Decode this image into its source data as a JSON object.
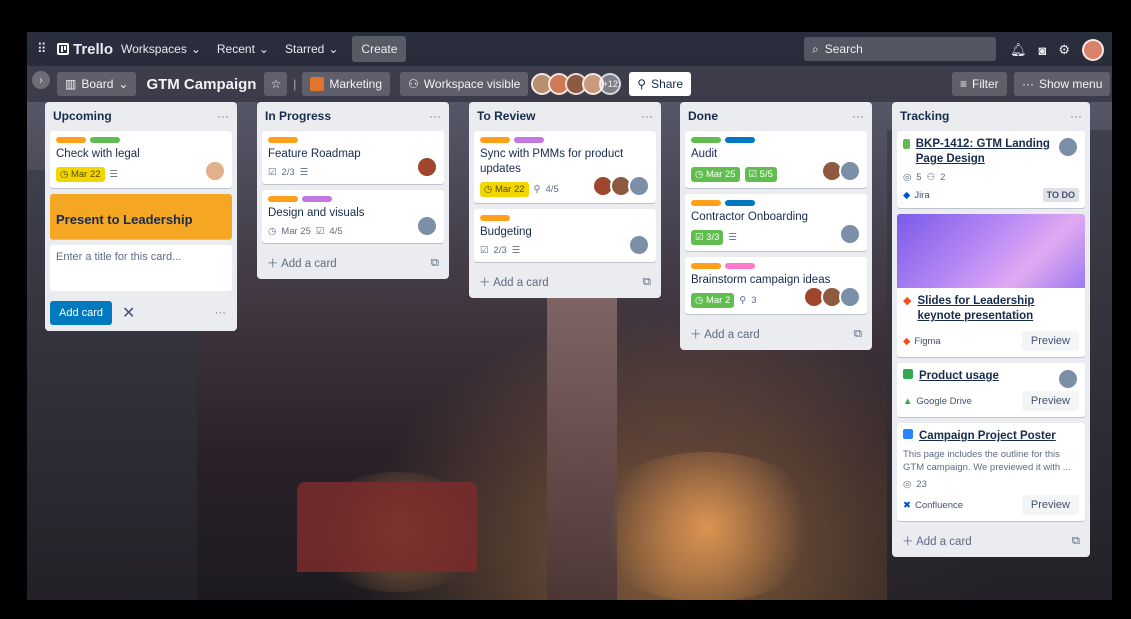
{
  "topbar": {
    "workspaces": "Workspaces",
    "recent": "Recent",
    "starred": "Starred",
    "create": "Create",
    "search_placeholder": "Search",
    "logo": "Trello"
  },
  "board": {
    "view": "Board",
    "title": "GTM Campaign",
    "team": "Marketing",
    "visibility": "Workspace visible",
    "members_more": "+12",
    "share": "Share",
    "filter": "Filter",
    "show_menu": "Show menu"
  },
  "lists": [
    {
      "title": "Upcoming",
      "cards": [
        {
          "title": "Check with legal",
          "date": "Mar 22"
        }
      ],
      "big_card": "Present to Leadership",
      "composer_placeholder": "Enter a title for this card...",
      "add_button": "Add card"
    },
    {
      "title": "In Progress",
      "cards": [
        {
          "title": "Feature Roadmap",
          "checklist": "2/3"
        },
        {
          "title": "Design and visuals",
          "date": "Mar 25",
          "checklist": "4/5"
        }
      ],
      "add": "Add a card"
    },
    {
      "title": "To Review",
      "cards": [
        {
          "title": "Sync with PMMs for product updates",
          "date": "Mar 22",
          "attachments": "4/5"
        },
        {
          "title": "Budgeting",
          "checklist": "2/3"
        }
      ],
      "add": "Add a card"
    },
    {
      "title": "Done",
      "cards": [
        {
          "title": "Audit",
          "date": "Mar 25",
          "checklist": "5/5"
        },
        {
          "title": "Contractor Onboarding",
          "checklist": "3/3"
        },
        {
          "title": "Brainstorm campaign ideas",
          "date": "Mar 2",
          "attachments": "3"
        }
      ],
      "add": "Add a card"
    },
    {
      "title": "Tracking",
      "cards": [
        {
          "title": "BKP-1412: GTM Landing Page Design",
          "comments": "5",
          "members": "2",
          "source": "Jira",
          "status": "TO DO"
        },
        {
          "title": "Slides for Leadership keynote presentation",
          "source": "Figma",
          "action": "Preview"
        },
        {
          "title": "Product usage",
          "source": "Google Drive",
          "action": "Preview"
        },
        {
          "title": "Campaign Project Poster",
          "description": "This page includes the outline for this GTM campaign. We previewed it with ...",
          "comments": "23",
          "source": "Confluence",
          "action": "Preview"
        }
      ],
      "add": "Add a card"
    }
  ],
  "colors": {
    "green": "#61bd4f",
    "yellow": "#f2d600",
    "orange": "#ff9f1a",
    "purple": "#c377e0",
    "blue": "#0079bf",
    "teal": "#00c2e0"
  }
}
